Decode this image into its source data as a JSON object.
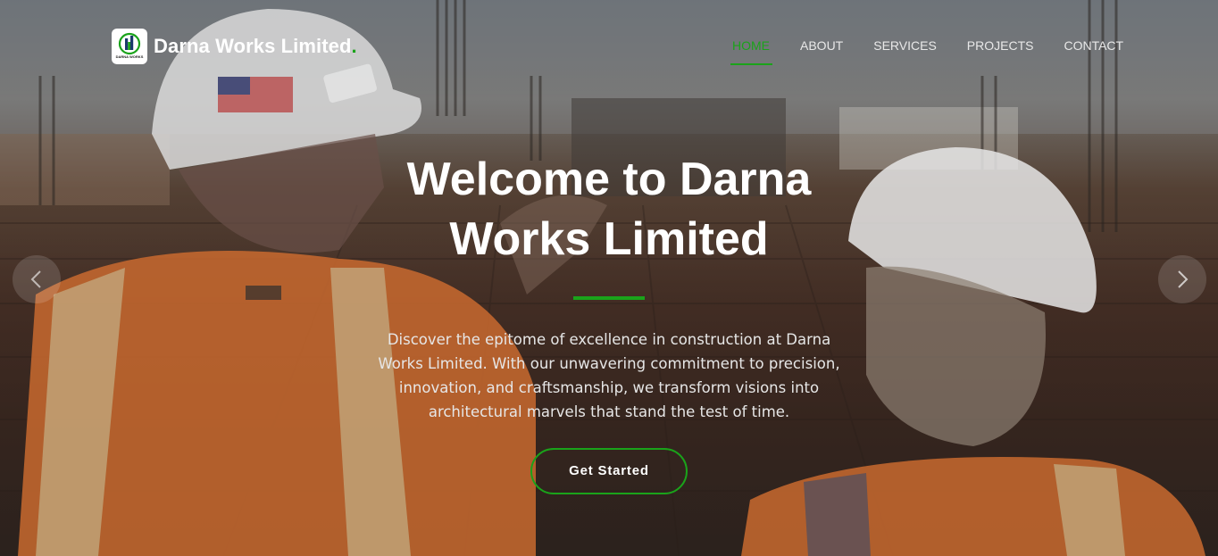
{
  "brand": {
    "name": "Darna Works Limited",
    "dot": ".",
    "logo_caption": "DARNA WORKS"
  },
  "nav": {
    "items": [
      {
        "label": "HOME",
        "active": true
      },
      {
        "label": "ABOUT",
        "active": false
      },
      {
        "label": "SERVICES",
        "active": false
      },
      {
        "label": "PROJECTS",
        "active": false
      },
      {
        "label": "CONTACT",
        "active": false
      }
    ]
  },
  "hero": {
    "title": "Welcome to Darna Works Limited",
    "description": "Discover the epitome of excellence in construction at Darna Works Limited. With our unwavering commitment to precision, innovation, and craftsmanship, we transform visions into architectural marvels that stand the test of time.",
    "cta_label": "Get Started"
  },
  "carousel": {
    "prev_icon": "chevron-left-icon",
    "next_icon": "chevron-right-icon"
  },
  "colors": {
    "accent": "#1aa31a",
    "text": "#ffffff"
  }
}
